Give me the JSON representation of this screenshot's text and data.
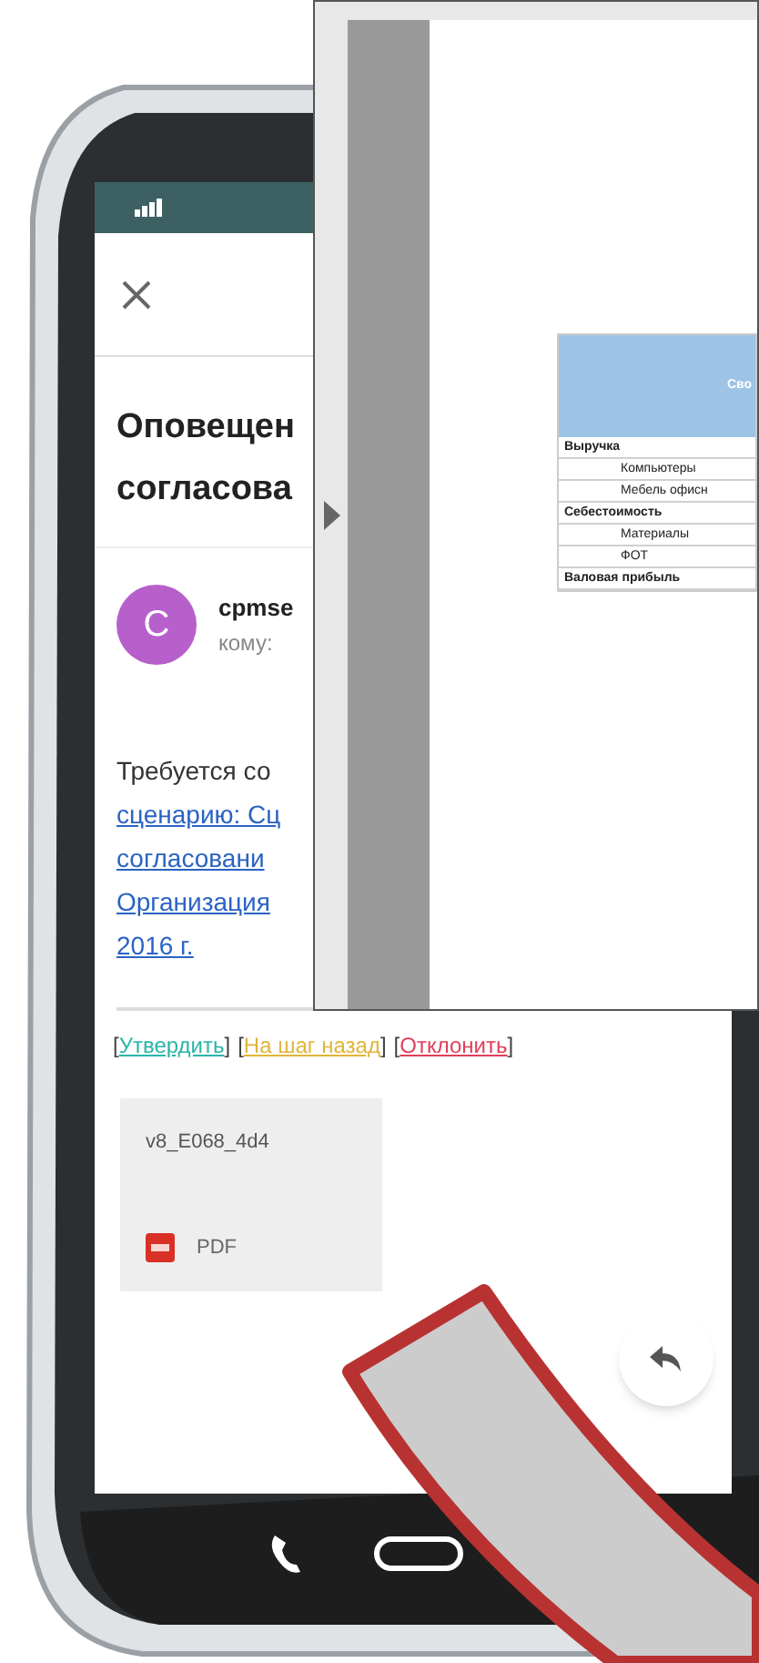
{
  "email": {
    "title_lines": [
      "Оповещен",
      "согласова"
    ],
    "sender": {
      "initial": "C",
      "name": "cpmse",
      "to": "кому:"
    },
    "body": {
      "text": "Требуется со",
      "links": [
        "сценарию: Сц",
        "согласовани",
        "Организация",
        "2016 г."
      ]
    },
    "actions": [
      {
        "before": "[",
        "label": "Утвердить",
        "after": "]",
        "color": "#2bb5a8"
      },
      {
        "before": "[",
        "label": "На шаг назад",
        "after": "]",
        "color": "#e0b53a"
      },
      {
        "before": "[",
        "label": "Отклонить",
        "after": "]",
        "color": "#e0405a"
      }
    ],
    "attachment": {
      "name": "v8_E068_4d4",
      "type": "PDF"
    }
  },
  "document_window": {
    "table": {
      "header": "Сво",
      "rows": [
        {
          "label": "Выручка",
          "children": [
            {
              "label": "Компьютеры"
            },
            {
              "label": "Мебель офисн"
            }
          ]
        },
        {
          "label": "Себестоимость",
          "children": [
            {
              "label": "Материалы"
            },
            {
              "label": "ФОТ"
            }
          ]
        },
        {
          "label": "Валовая прибыль"
        }
      ]
    }
  }
}
